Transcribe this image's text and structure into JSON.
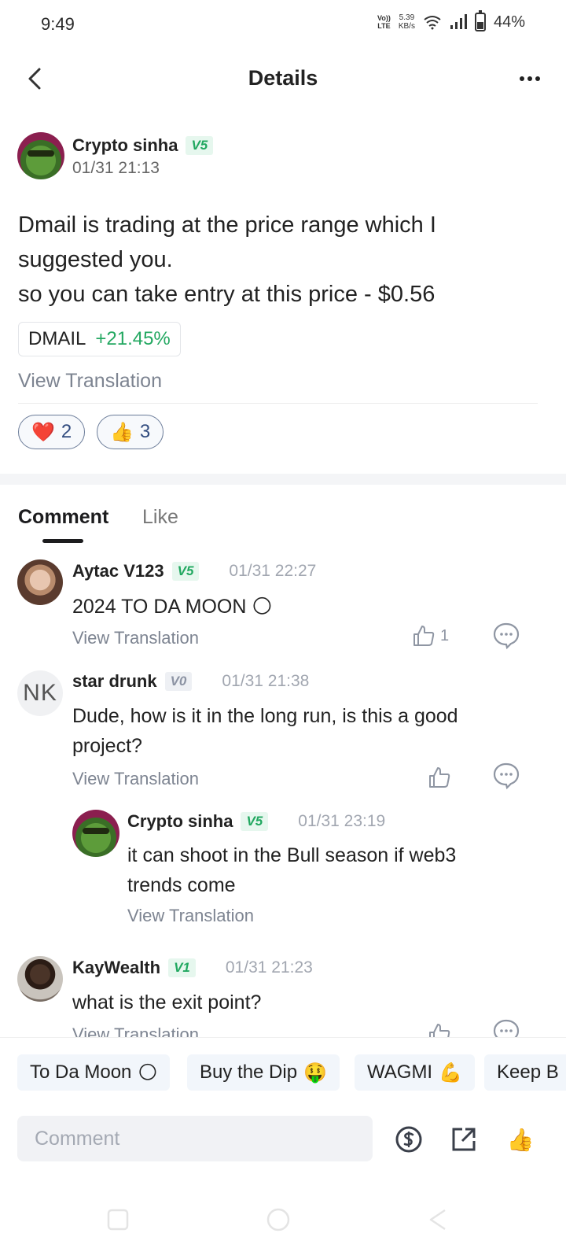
{
  "status_bar": {
    "time": "9:49",
    "volte_top": "Vo))",
    "volte_bottom": "LTE",
    "net_speed_value": "5.39",
    "net_speed_unit": "KB/s",
    "battery": "44%",
    "battery_level": 0.44
  },
  "header": {
    "title": "Details"
  },
  "post": {
    "author": "Crypto sinha",
    "level": "V5",
    "timestamp": "01/31 21:13",
    "body_lines": [
      "Dmail is trading at the price range which I",
      "suggested you.",
      "so you can take entry at this price - $0.56"
    ],
    "ticker": {
      "symbol": "DMAIL",
      "change": "+21.45%"
    },
    "view_translation": "View Translation",
    "reactions": [
      {
        "icon": "heart-emoji",
        "glyph": "❤️",
        "count": "2"
      },
      {
        "icon": "thumbs-up-emoji",
        "glyph": "👍",
        "count": "3"
      }
    ]
  },
  "tabs": [
    {
      "label": "Comment",
      "active": true
    },
    {
      "label": "Like",
      "active": false
    }
  ],
  "comments": [
    {
      "author": "Aytac V123",
      "level": "V5",
      "timestamp": "01/31 22:27",
      "text": "2024 TO DA MOON 🌕",
      "view_translation": "View Translation",
      "like_count": "1"
    },
    {
      "author": "star drunk",
      "avatar_initials": "NK",
      "level": "V0",
      "timestamp": "01/31 21:38",
      "text_lines": [
        "Dude, how is it in the long run, is this a good",
        "project?"
      ],
      "view_translation": "View Translation",
      "like_count": ""
    },
    {
      "author": "Crypto sinha",
      "level": "V5",
      "timestamp": "01/31 23:19",
      "text_lines": [
        "it can shoot in the Bull season if web3",
        "trends come"
      ],
      "view_translation": "View Translation"
    },
    {
      "author": "KayWealth",
      "level": "V1",
      "timestamp": "01/31 21:23",
      "text": "what is the exit point?",
      "view_translation": "View Translation"
    }
  ],
  "quick_replies": [
    {
      "label": "To Da Moon",
      "emoji": "🌕"
    },
    {
      "label": "Buy the Dip",
      "emoji": "🤑"
    },
    {
      "label": "WAGMI",
      "emoji": "💪"
    },
    {
      "label": "Keep B",
      "emoji": ""
    }
  ],
  "comment_bar": {
    "placeholder": "Comment",
    "icons": [
      "tip-coin-icon",
      "share-icon",
      "thumbs-up-emoji"
    ],
    "thumb_glyph": "👍"
  },
  "colors": {
    "accent_green": "#23a861",
    "level_badge_bg": "#e6f7ee",
    "reaction_border": "#6b7c99"
  }
}
